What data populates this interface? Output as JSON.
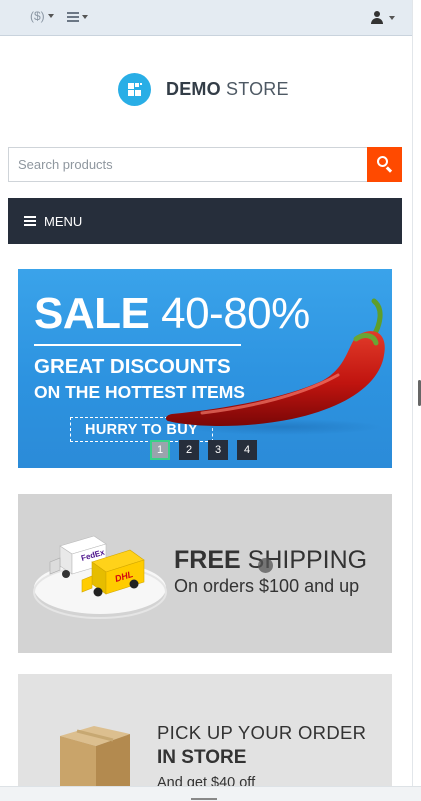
{
  "topbar": {
    "currency_label": "($)",
    "list_icon": "list-icon",
    "user_icon": "user-icon"
  },
  "logo": {
    "brand_bold": "DEMO",
    "brand_light": "STORE",
    "accent_color": "#29aee6"
  },
  "search": {
    "placeholder": "Search products",
    "value": "",
    "button_icon": "search-icon",
    "button_color": "#ff4a00"
  },
  "menu": {
    "label": "MENU",
    "icon": "hamburger-icon",
    "background": "#262e3b"
  },
  "banners": {
    "sale": {
      "sale_word": "SALE",
      "sale_range": "40-80%",
      "line1": "GREAT DISCOUNTS",
      "line2": "ON THE HOTTEST ITEMS",
      "cta": "HURRY TO BUY"
    },
    "slider_dots": [
      "1",
      "2",
      "3",
      "4"
    ],
    "active_slide": "1",
    "shipping": {
      "title_bold": "FREE",
      "title_rest": "SHIPPING",
      "subtitle": "On orders $100 and up",
      "truck1_brand": "FedEx",
      "truck2_brand": "DHL"
    },
    "pickup": {
      "line1": "PICK UP YOUR ORDER",
      "line2": "IN STORE",
      "line3": "And get $40 off"
    }
  }
}
